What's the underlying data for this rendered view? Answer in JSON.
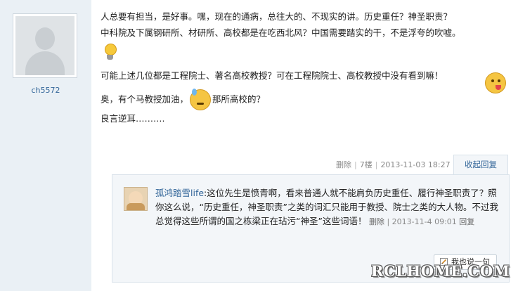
{
  "post": {
    "username": "ch5572",
    "line1": "人总要有担当，是好事。嘿，现在的通病，总往大的、不现实的讲。历史重任？神圣职责？",
    "line2": "中科院及下属钢研所、材研所、高校都是在吃西北风？中国需要踏实的干，不是浮夸的吹嘘。",
    "line3": "可能上述几位都是工程院士、著名高校教授？可在工程院院士、高校教授中没有看到嘛！",
    "line4_a": "奥，有个马教授加油，",
    "line4_b": "那所高校的？",
    "line5": "良言逆耳………."
  },
  "meta": {
    "delete": "删除",
    "floor": "7楼",
    "time": "2013-11-03 18:27",
    "collapse_reply": "收起回复"
  },
  "reply": {
    "user": "孤鸿踏雪life",
    "text": "这位先生是愤青啊，看来普通人就不能肩负历史重任、履行神圣职责了？照你这么说，“历史重任，神圣职责”之类的词汇只能用于教授、院士之类的大人物。不过我总觉得这些所谓的国之栋梁正在玷污“神圣”这些词语！",
    "delete": "删除",
    "time": "2013-11-4 09:01",
    "reply_label": "回复"
  },
  "say_button": "我也说一句",
  "watermark": "RCLHOME.COM",
  "icons": {
    "bulb": "lightbulb-icon",
    "tongue_emoji": "tongue-out-emoji-icon",
    "sweat_emoji": "sweat-emoji-icon",
    "pencil": "pencil-icon"
  },
  "colors": {
    "sidebar_bg": "#eaf0f5",
    "link": "#336699",
    "reply_bg": "#f3f6f9"
  }
}
